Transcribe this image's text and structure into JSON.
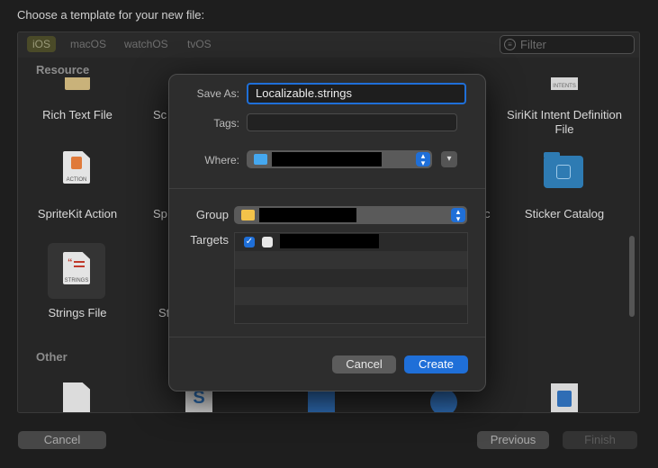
{
  "header": {
    "title": "Choose a template for your new file:"
  },
  "platform_tabs": [
    {
      "label": "iOS"
    },
    {
      "label": "macOS"
    },
    {
      "label": "watchOS"
    },
    {
      "label": "tvOS"
    }
  ],
  "filter": {
    "placeholder": "Filter"
  },
  "sections": {
    "resource": "Resource",
    "other": "Other"
  },
  "templates": {
    "rich_text": "Rich Text File",
    "rich_text_partial": "Sc",
    "spritekit_action": "SpriteKit Action",
    "spritekit_partial": "Sp",
    "strings_file": "Strings File",
    "strings_partial": "St",
    "sirikit_intent": "SiriKit Intent Definition File",
    "sticker_catalog": "Sticker Catalog",
    "right_partial": "c"
  },
  "icon_texts": {
    "action": "ACTION",
    "strings": "STRINGS",
    "intents": "INTENTS",
    "s": "S"
  },
  "dialog": {
    "save_as_label": "Save As:",
    "save_as_value": "Localizable.strings",
    "tags_label": "Tags:",
    "where_label": "Where:",
    "group_label": "Group",
    "targets_label": "Targets",
    "cancel_label": "Cancel",
    "create_label": "Create"
  },
  "footer": {
    "cancel": "Cancel",
    "previous": "Previous",
    "finish": "Finish"
  },
  "colors": {
    "accent": "#1f6fd8",
    "folder_blue": "#45a8f0",
    "folder_yellow": "#f3c34a"
  }
}
